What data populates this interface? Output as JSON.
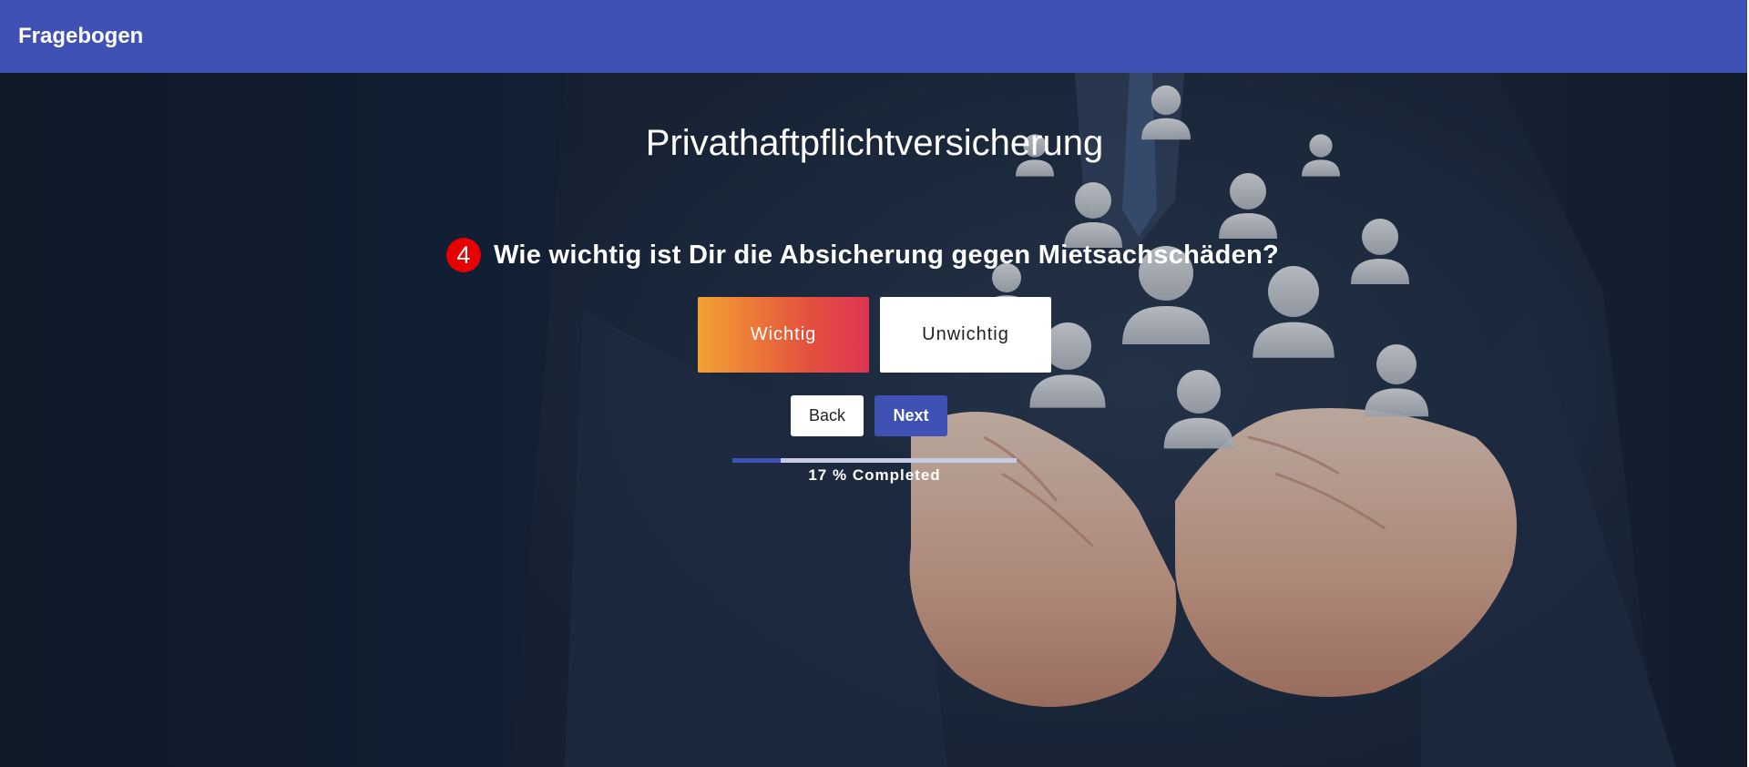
{
  "app": {
    "title": "Fragebogen"
  },
  "survey": {
    "title": "Privathaftpflichtversicherung"
  },
  "question": {
    "number": "4",
    "text": "Wie wichtig ist Dir die Absicherung gegen Mietsachschäden?"
  },
  "options": [
    {
      "label": "Wichtig",
      "selected": true
    },
    {
      "label": "Unwichtig",
      "selected": false
    }
  ],
  "navigation": {
    "back_label": "Back",
    "next_label": "Next"
  },
  "progress": {
    "percent": 17,
    "label": "17 % Completed"
  },
  "colors": {
    "primary": "#3f51b5",
    "badge": "#e60000",
    "selected_gradient_start": "#f3a233",
    "selected_gradient_end": "#dd3553"
  }
}
